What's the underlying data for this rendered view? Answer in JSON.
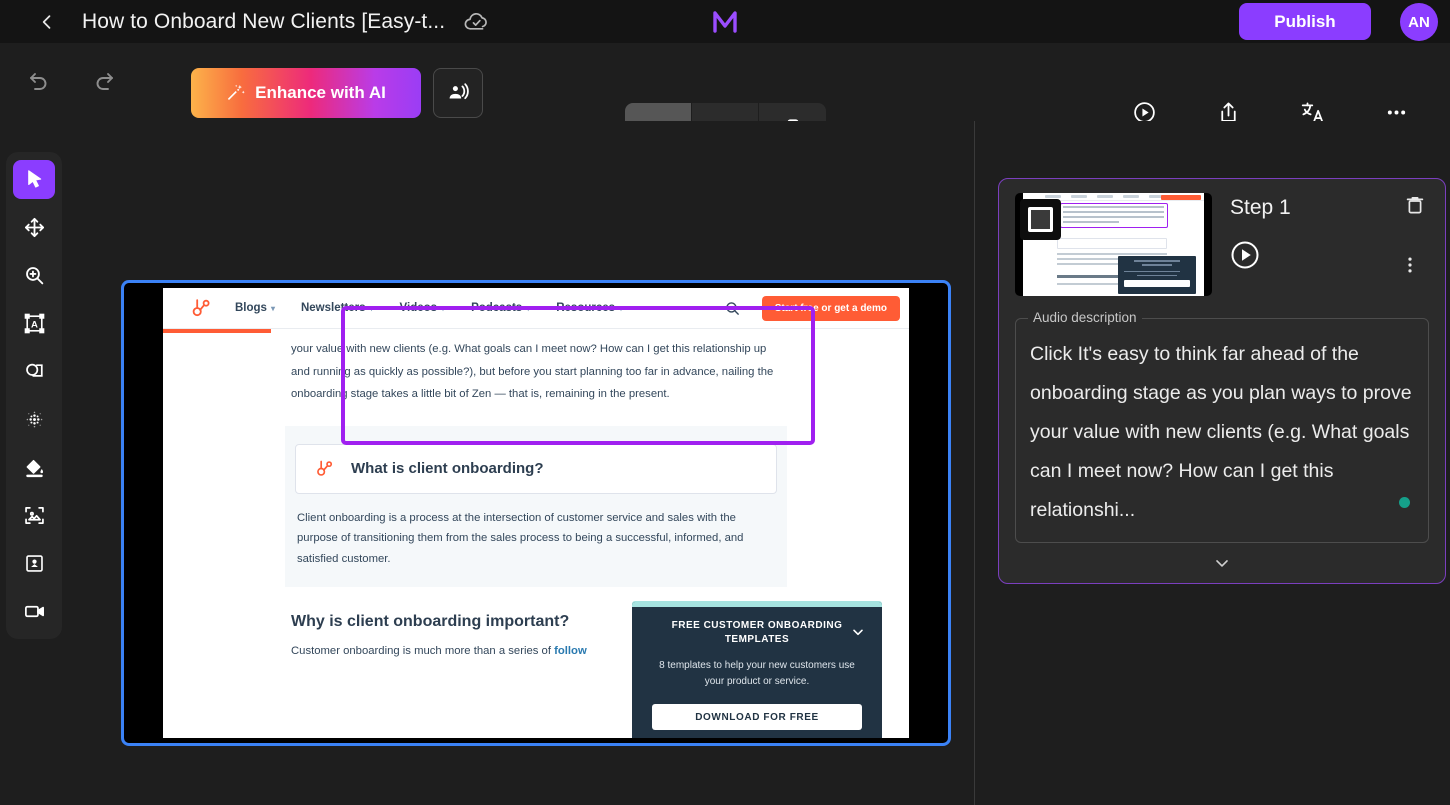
{
  "titlebar": {
    "back_icon": "chevron-left-icon",
    "title": "How to Onboard New Clients [Easy-t...",
    "saved_icon": "cloud-check-icon",
    "brand_icon": "scribe-logo-icon",
    "publish_label": "Publish",
    "avatar_initials": "AN",
    "accent_color": "#8b3dff"
  },
  "toolbar": {
    "undo_icon": "undo-icon",
    "redo_icon": "redo-icon",
    "enhance_label": "Enhance with AI",
    "enhance_icon": "magic-wand-icon",
    "voice_icon": "voice-narration-icon",
    "ratios": [
      {
        "name": "landscape",
        "icon": "rectangle-landscape-icon",
        "active": true
      },
      {
        "name": "square",
        "icon": "rectangle-square-icon",
        "active": false
      },
      {
        "name": "portrait",
        "icon": "rectangle-portrait-icon",
        "active": false
      }
    ],
    "actions": [
      {
        "label": "Preview",
        "icon": "play-circle-icon"
      },
      {
        "label": "Share",
        "icon": "share-upload-icon"
      },
      {
        "label": "Translate",
        "icon": "translate-icon"
      },
      {
        "label": "More",
        "icon": "ellipsis-icon"
      }
    ]
  },
  "tools": [
    {
      "name": "select",
      "icon": "cursor-arrow-icon",
      "active": true
    },
    {
      "name": "move",
      "icon": "move-arrows-icon",
      "active": false
    },
    {
      "name": "zoom",
      "icon": "magnifier-plus-icon",
      "active": false
    },
    {
      "name": "text",
      "icon": "text-box-icon",
      "active": false
    },
    {
      "name": "shape",
      "icon": "shape-icon",
      "active": false
    },
    {
      "name": "blur",
      "icon": "blur-dots-icon",
      "active": false
    },
    {
      "name": "fill",
      "icon": "paint-bucket-icon",
      "active": false
    },
    {
      "name": "image",
      "icon": "image-frame-icon",
      "active": false
    },
    {
      "name": "sticker",
      "icon": "badge-icon",
      "active": false
    },
    {
      "name": "video",
      "icon": "video-camera-icon",
      "active": false
    }
  ],
  "canvas": {
    "selection_color": "#3b82f6",
    "highlight_color": "#a020f0",
    "site": {
      "logo_icon": "hubspot-logo-icon",
      "menu": [
        "Blogs",
        "Newsletters",
        "Videos",
        "Podcasts",
        "Resources"
      ],
      "search_icon": "search-icon",
      "cta_label": "Start free or get a demo",
      "cta_color": "#ff5c35"
    },
    "highlighted_paragraph": "your value with new clients (e.g. What goals can I meet now? How can I get this relationship up and running as quickly as possible?), but before you start planning too far in advance, nailing the onboarding stage takes a little bit of Zen — that is, remaining in the present.",
    "question_box": {
      "icon": "hubspot-sprocket-icon",
      "title": "What is client onboarding?"
    },
    "definition": "Client onboarding is a process at the intersection of customer service and sales with the purpose of transitioning them from the sales process to being a successful, informed, and satisfied customer.",
    "section_heading": "Why is client onboarding important?",
    "section_paragraph": "Customer onboarding is much more than a series of ",
    "section_link": "follow",
    "cta_card": {
      "heading": "FREE CUSTOMER ONBOARDING TEMPLATES",
      "subheading": "8 templates to help your new customers use your product or service.",
      "button_label": "DOWNLOAD FOR FREE",
      "chevron_icon": "chevron-down-icon",
      "bg_color": "#213343",
      "strip_color": "#a6e3e0"
    }
  },
  "side_panel": {
    "border_color": "#7b3fbf",
    "step_title": "Step 1",
    "thumbnail_icon": "step-thumbnail",
    "badge_icon": "click-target-icon",
    "play_icon": "play-circle-icon",
    "delete_icon": "trash-icon",
    "menu_icon": "kebab-menu-icon",
    "audio_legend": "Audio description",
    "audio_text": "Click It's easy to think far ahead of the onboarding stage as you plan ways to prove your value with new clients (e.g. What goals can I meet now? How can I get this relationshi...",
    "audio_marker_color": "#15a08a",
    "expand_icon": "chevron-down-icon"
  }
}
